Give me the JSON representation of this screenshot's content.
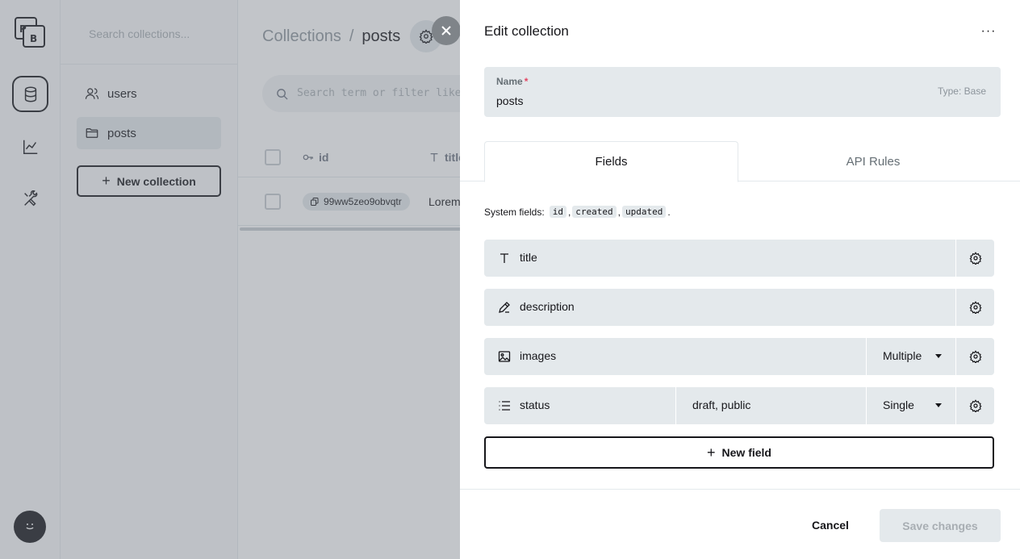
{
  "rail": {
    "logo_letters": "PB",
    "items": [
      {
        "icon": "database-icon",
        "active": true
      },
      {
        "icon": "chart-line-icon",
        "active": false
      },
      {
        "icon": "tools-icon",
        "active": false
      }
    ],
    "avatar_icon": "smile-icon"
  },
  "sidebar": {
    "search_placeholder": "Search collections...",
    "collections": [
      {
        "label": "users",
        "icon": "users-icon",
        "active": false
      },
      {
        "label": "posts",
        "icon": "folder-icon",
        "active": true
      }
    ],
    "new_collection_label": "New collection"
  },
  "main": {
    "breadcrumb_root": "Collections",
    "breadcrumb_sep": "/",
    "breadcrumb_current": "posts",
    "search_placeholder": "Search term or filter like c",
    "columns": [
      {
        "label": "id",
        "icon": "key-icon"
      },
      {
        "label": "title",
        "icon": "text-icon"
      }
    ],
    "row": {
      "id": "99ww5zeo9obvqtr",
      "title": "Lorem"
    }
  },
  "panel": {
    "title": "Edit collection",
    "more_label": "···",
    "name_label": "Name",
    "required_mark": "*",
    "name_value": "posts",
    "type_label": "Type: Base",
    "tabs": [
      "Fields",
      "API Rules"
    ],
    "system_fields_label": "System fields:",
    "system_fields": [
      "id",
      "created",
      "updated"
    ],
    "fields": [
      {
        "name": "title",
        "icon": "text-icon"
      },
      {
        "name": "description",
        "icon": "pencil-icon"
      },
      {
        "name": "images",
        "icon": "image-icon",
        "select": "Multiple"
      },
      {
        "name": "status",
        "icon": "list-icon",
        "options": "draft, public",
        "select": "Single"
      }
    ],
    "new_field_label": "New field",
    "cancel_label": "Cancel",
    "save_label": "Save changes"
  },
  "colors": {
    "text": "#16161a",
    "field_bg": "#e4e9ec",
    "required": "#e34562",
    "overlay": "rgba(110,117,126,0.42)"
  }
}
